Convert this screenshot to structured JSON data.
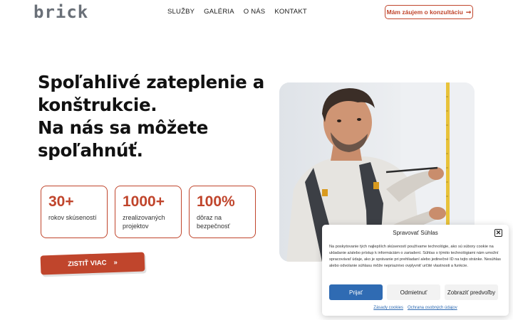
{
  "header": {
    "logo": "brick",
    "nav": [
      "SLUŽBY",
      "GALÉRIA",
      "O NÁS",
      "KONTAKT"
    ],
    "cta_label": "Mám záujem o konzultáciu",
    "cta_arrow": "➞"
  },
  "hero": {
    "title_lines": [
      "Spoľahlivé zateplenie a",
      "konštrukcie.",
      "Na nás sa môžete",
      "spoľahnúť."
    ],
    "stats": [
      {
        "value": "30+",
        "label": "rokov skúseností"
      },
      {
        "value": "1000+",
        "label": "zrealizovaných projektov"
      },
      {
        "value": "100%",
        "label": "dôraz na bezpečnosť"
      }
    ],
    "cta_label": "ZISTIŤ VIAC",
    "cta_arrow": "»"
  },
  "consent": {
    "title": "Spravovať Súhlas",
    "close": "✕",
    "text": "Na poskytovanie tých najlepších skúseností používame technológie, ako sú súbory cookie na ukladanie a/alebo prístup k informáciám o zariadení. Súhlas s týmito technológiami nám umožní spracovávať údaje, ako je správanie pri prehliadaní alebo jedinečné ID na tejto stránke. Nesúhlas alebo odvolanie súhlasu môže nepriaznivo ovplyvniť určité vlastnosti a funkcie.",
    "buttons": {
      "accept": "Prijať",
      "deny": "Odmietnuť",
      "preferences": "Zobraziť predvoľby"
    },
    "links": {
      "cookies": "Zásady cookies",
      "privacy": "Ochrana osobných údajov"
    }
  },
  "colors": {
    "accent": "#c0452c",
    "consent_primary": "#2f6bb3"
  }
}
